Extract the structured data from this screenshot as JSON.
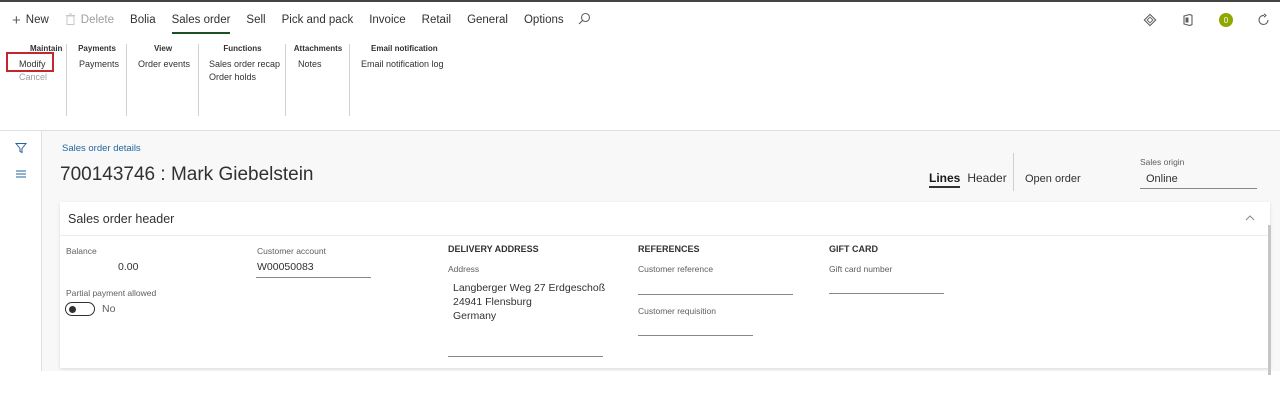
{
  "toolbar": {
    "new_label": "New",
    "delete_label": "Delete",
    "tabs": [
      "Bolia",
      "Sales order",
      "Sell",
      "Pick and pack",
      "Invoice",
      "Retail",
      "General",
      "Options"
    ],
    "active_tab": "Sales order",
    "notification_count": "0"
  },
  "ribbon": {
    "maintain": {
      "title": "Maintain",
      "items": [
        "Modify",
        "Cancel"
      ]
    },
    "payments": {
      "title": "Payments",
      "items": [
        "Payments"
      ]
    },
    "view": {
      "title": "View",
      "items": [
        "Order events"
      ]
    },
    "functions": {
      "title": "Functions",
      "items": [
        "Sales order recap",
        "Order holds"
      ]
    },
    "attachments": {
      "title": "Attachments",
      "items": [
        "Notes"
      ]
    },
    "email": {
      "title": "Email notification",
      "items": [
        "Email notification log"
      ]
    }
  },
  "page": {
    "breadcrumb": "Sales order details",
    "title": "700143746 : Mark Giebelstein",
    "view_lines": "Lines",
    "view_header": "Header",
    "status": "Open order",
    "sales_origin_label": "Sales origin",
    "sales_origin_value": "Online"
  },
  "header_card": {
    "title": "Sales order header",
    "balance_label": "Balance",
    "balance_value": "0.00",
    "customer_account_label": "Customer account",
    "customer_account_value": "W00050083",
    "partial_payment_label": "Partial payment allowed",
    "partial_payment_value": "No",
    "delivery_heading": "DELIVERY ADDRESS",
    "address_label": "Address",
    "address_lines": [
      "Langberger Weg 27 Erdgeschoß",
      "24941 Flensburg",
      "Germany"
    ],
    "references_heading": "REFERENCES",
    "customer_reference_label": "Customer reference",
    "customer_requisition_label": "Customer requisition",
    "gift_card_heading": "GIFT CARD",
    "gift_card_number_label": "Gift card number"
  },
  "colors": {
    "accent_underline": "#1a5228",
    "highlight_box": "#c4262e",
    "link": "#2266a0",
    "badge": "#8fa800"
  }
}
